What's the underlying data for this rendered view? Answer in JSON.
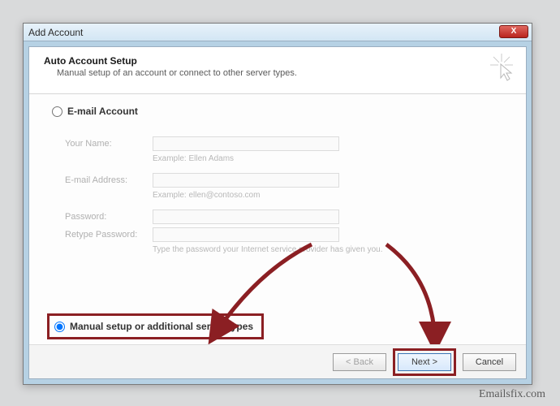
{
  "window": {
    "title": "Add Account",
    "close_label": "X"
  },
  "header": {
    "title": "Auto Account Setup",
    "subtitle": "Manual setup of an account or connect to other server types."
  },
  "option1": {
    "label": "E-mail Account"
  },
  "fields": {
    "name_label": "Your Name:",
    "name_hint": "Example: Ellen Adams",
    "email_label": "E-mail Address:",
    "email_hint": "Example: ellen@contoso.com",
    "password_label": "Password:",
    "retype_label": "Retype Password:",
    "password_hint": "Type the password your Internet service provider has given you."
  },
  "option2": {
    "label": "Manual setup or additional server types"
  },
  "footer": {
    "back": "< Back",
    "next": "Next >",
    "cancel": "Cancel"
  },
  "watermark": "Emailsfix.com"
}
